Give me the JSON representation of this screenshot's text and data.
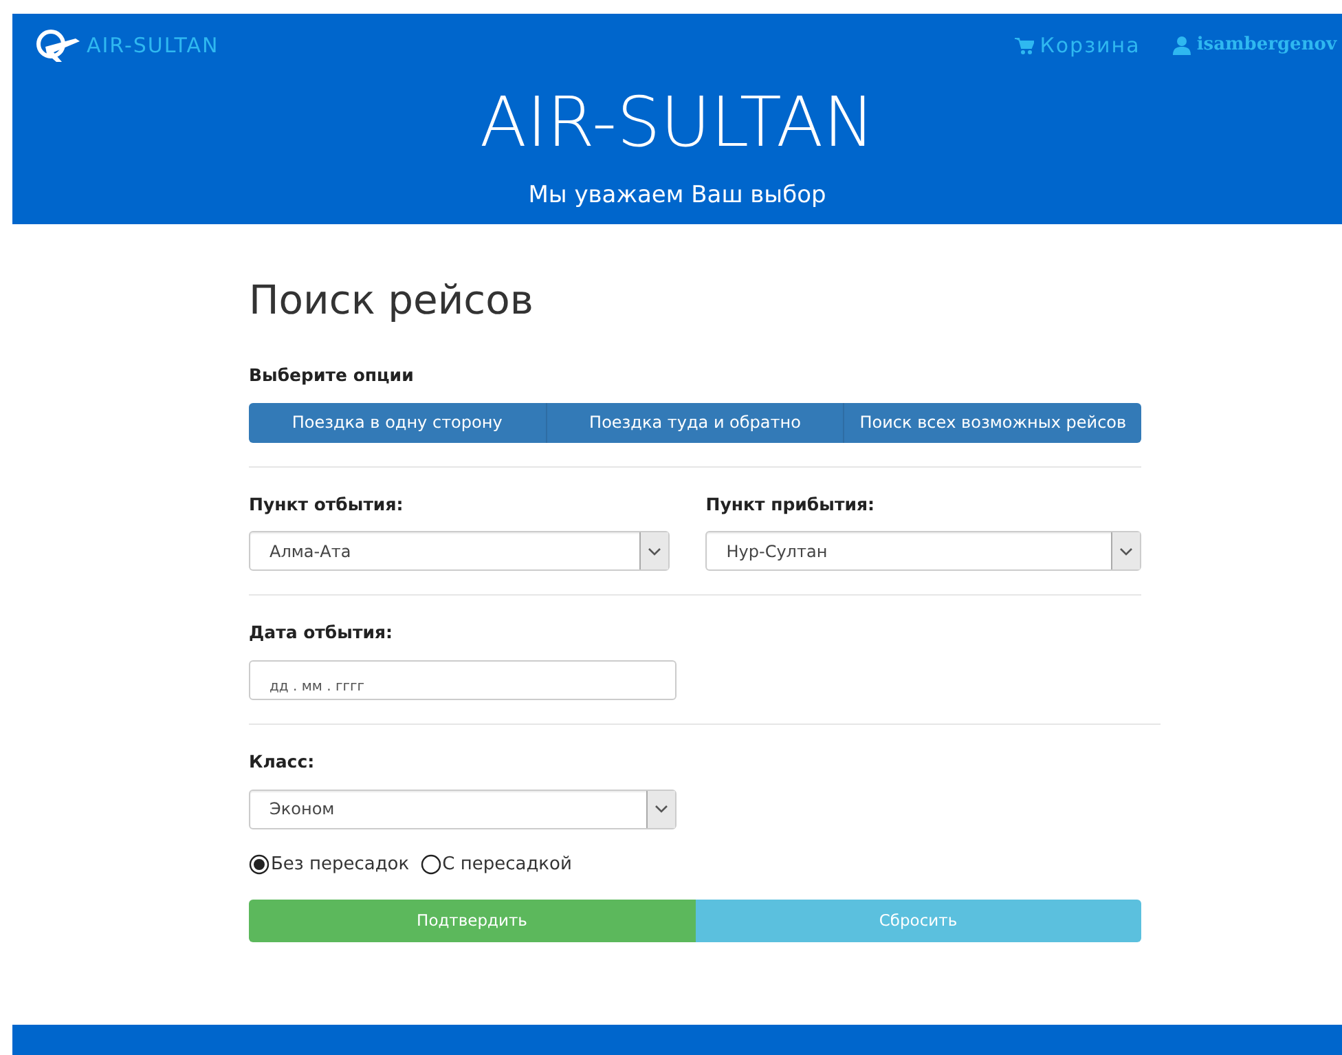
{
  "navbar": {
    "brand": "AIR-SULTAN",
    "links": [
      {
        "kind": "cart",
        "label": "Корзина"
      },
      {
        "kind": "user",
        "label": "isambergenov"
      }
    ]
  },
  "hero": {
    "title": "AIR-SULTAN",
    "subtitle": "Мы уважаем Ваш выбор"
  },
  "page_title": "Поиск рейсов",
  "options": {
    "label": "Выберите опции",
    "buttons": [
      "Поездка в одну сторону",
      "Поездка туда и обратно",
      "Поиск всех возможных рейсов"
    ]
  },
  "departure": {
    "label": "Пункт отбытия:",
    "value": "Алма-Ата"
  },
  "arrival": {
    "label": "Пункт прибытия:",
    "value": "Нур-Султан"
  },
  "date": {
    "label": "Дата отбытия:",
    "placeholder": "дд . мм . гггг"
  },
  "class": {
    "label": "Класс:",
    "value": "Эконом"
  },
  "transfer": [
    {
      "label": "Без пересадок",
      "selected": true
    },
    {
      "label": "С пересадкой",
      "selected": false
    }
  ],
  "actions": [
    {
      "kind": "submit",
      "label": "Подтвердить"
    },
    {
      "kind": "reset",
      "label": "Сбросить"
    }
  ]
}
